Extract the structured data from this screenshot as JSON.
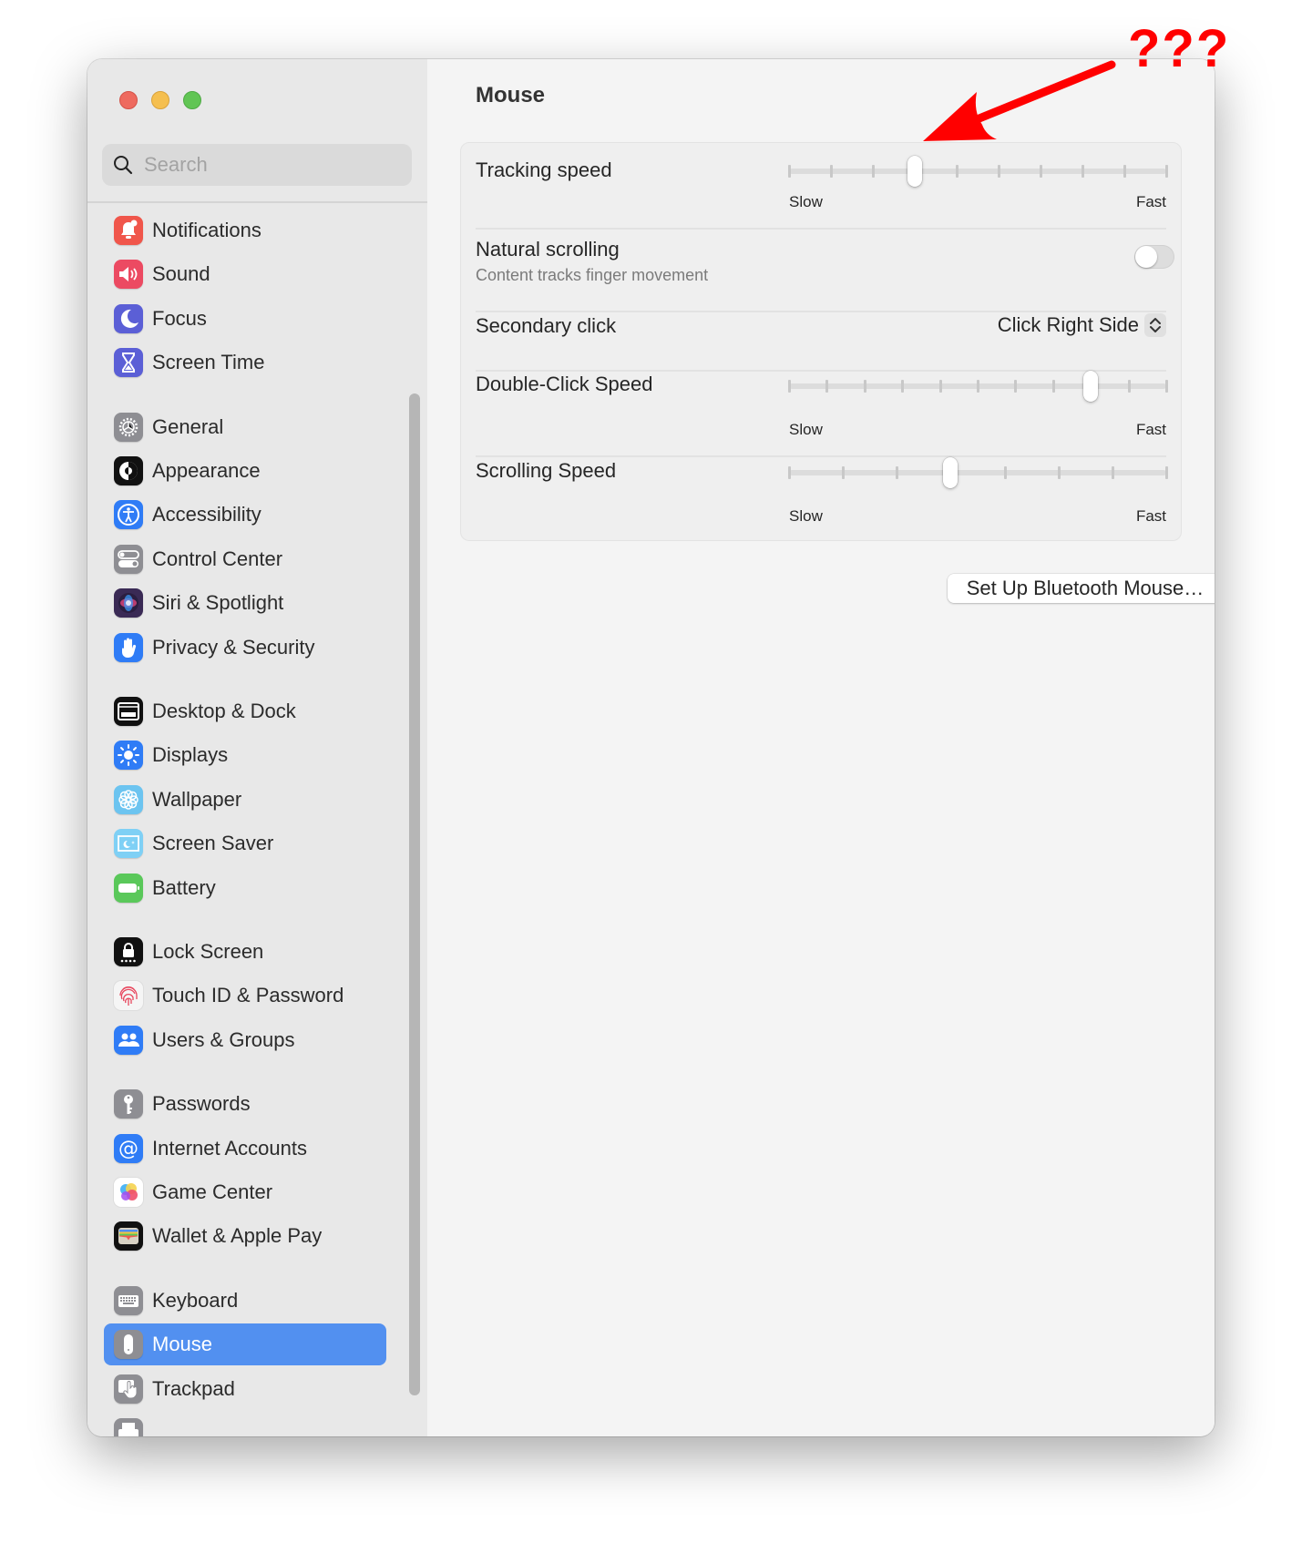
{
  "window": {
    "traffic_lights": [
      {
        "name": "close",
        "color": "#ee6a5f"
      },
      {
        "name": "minimize",
        "color": "#f5bf4f"
      },
      {
        "name": "zoom",
        "color": "#61c554"
      }
    ]
  },
  "sidebar": {
    "search": {
      "placeholder": "Search",
      "value": ""
    },
    "items": [
      {
        "label": "Notifications",
        "icon": "bell-icon",
        "color": "#f0564b"
      },
      {
        "label": "Sound",
        "icon": "speaker-icon",
        "color": "#ec4a62"
      },
      {
        "label": "Focus",
        "icon": "moon-icon",
        "color": "#5b5fd6"
      },
      {
        "label": "Screen Time",
        "icon": "hourglass-icon",
        "color": "#5b5fd6"
      },
      {
        "label": "General",
        "icon": "gear-icon",
        "color": "#8e8e93"
      },
      {
        "label": "Appearance",
        "icon": "appearance-icon",
        "color": "#111111"
      },
      {
        "label": "Accessibility",
        "icon": "accessibility-icon",
        "color": "#2f7cf6"
      },
      {
        "label": "Control Center",
        "icon": "toggles-icon",
        "color": "#8e8e93"
      },
      {
        "label": "Siri & Spotlight",
        "icon": "siri-icon",
        "color": "#3a2a55"
      },
      {
        "label": "Privacy & Security",
        "icon": "hand-icon",
        "color": "#2f7cf6"
      },
      {
        "label": "Desktop & Dock",
        "icon": "dock-icon",
        "color": "#111111"
      },
      {
        "label": "Displays",
        "icon": "sun-icon",
        "color": "#2f7cf6"
      },
      {
        "label": "Wallpaper",
        "icon": "flower-icon",
        "color": "#6cc4f0"
      },
      {
        "label": "Screen Saver",
        "icon": "screensaver-icon",
        "color": "#7fd0f5"
      },
      {
        "label": "Battery",
        "icon": "battery-icon",
        "color": "#5ac85a"
      },
      {
        "label": "Lock Screen",
        "icon": "lock-icon",
        "color": "#111111"
      },
      {
        "label": "Touch ID & Password",
        "icon": "fingerprint-icon",
        "color": "#f5f5f5"
      },
      {
        "label": "Users & Groups",
        "icon": "users-icon",
        "color": "#2f7cf6"
      },
      {
        "label": "Passwords",
        "icon": "key-icon",
        "color": "#8e8e93"
      },
      {
        "label": "Internet Accounts",
        "icon": "at-icon",
        "color": "#2f7cf6"
      },
      {
        "label": "Game Center",
        "icon": "game-center-icon",
        "color": "#ffffff"
      },
      {
        "label": "Wallet & Apple Pay",
        "icon": "wallet-icon",
        "color": "#111111"
      },
      {
        "label": "Keyboard",
        "icon": "keyboard-icon",
        "color": "#8e8e93"
      },
      {
        "label": "Mouse",
        "icon": "mouse-icon",
        "color": "#8e8e93",
        "selected": true
      },
      {
        "label": "Trackpad",
        "icon": "trackpad-icon",
        "color": "#8e8e93"
      },
      {
        "label": "",
        "icon": "printer-icon",
        "color": "#8e8e93"
      }
    ],
    "selected_color": "#5290f0"
  },
  "main": {
    "title": "Mouse",
    "settings": {
      "tracking_speed": {
        "label": "Tracking speed",
        "min_label": "Slow",
        "max_label": "Fast",
        "steps": 10,
        "value_index": 3
      },
      "natural_scrolling": {
        "label": "Natural scrolling",
        "description": "Content tracks finger movement",
        "enabled": false
      },
      "secondary_click": {
        "label": "Secondary click",
        "value": "Click Right Side"
      },
      "double_click_speed": {
        "label": "Double-Click Speed",
        "min_label": "Slow",
        "max_label": "Fast",
        "steps": 11,
        "value_index": 8
      },
      "scrolling_speed": {
        "label": "Scrolling Speed",
        "min_label": "Slow",
        "max_label": "Fast",
        "steps": 8,
        "value_index": 3
      }
    },
    "setup_button": "Set Up Bluetooth Mouse…",
    "help_button": "?"
  },
  "annotation": {
    "text": "???",
    "color": "#ff0000"
  }
}
